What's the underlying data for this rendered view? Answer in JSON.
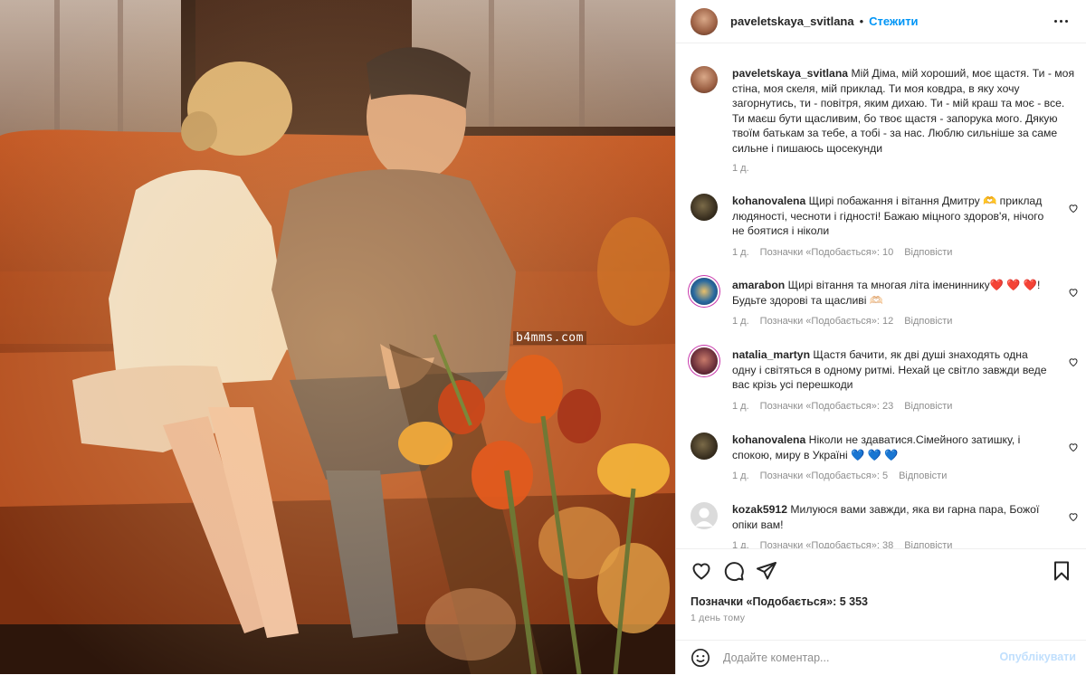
{
  "photo": {
    "watermark": "b4mms.com"
  },
  "header": {
    "username": "paveletskaya_svitlana",
    "separator": "•",
    "follow_label": "Стежити"
  },
  "caption": {
    "username": "paveletskaya_svitlana",
    "text": "Мій Діма, мій хороший, моє щастя. Ти - моя стіна, моя скеля, мій приклад. Ти моя ковдра, в яку хочу загорнутись, ти - повітря, яким дихаю. Ти - мій краш та моє - все. Ти маєш бути щасливим, бо твоє щастя - запорука мого. Дякую твоїм батькам за тебе, а тобі - за нас. Люблю сильніше за саме сильне і пишаюсь щосекунди",
    "time": "1 д."
  },
  "comments": [
    {
      "username": "kohanovalena",
      "text": "Щирі побажання і вітання Дмитру 🫶 приклад людяності, чесноти і гідності! Бажаю міцного здоров'я, нічого не боятися і ніколи",
      "time": "1 д.",
      "likes": "Позначки «Подобається»: 10",
      "reply": "Відповісти"
    },
    {
      "username": "amarabon",
      "text": "Щирі вітання та многая літа імениннику❤️ ❤️ ❤️! Будьте здорові та щасливі 🫶🏻",
      "time": "1 д.",
      "likes": "Позначки «Подобається»: 12",
      "reply": "Відповісти"
    },
    {
      "username": "natalia_martyn",
      "text": "Щастя бачити, як дві душі знаходять одна одну і світяться в одному ритмі. Нехай це світло завжди веде вас крізь усі перешкоди",
      "time": "1 д.",
      "likes": "Позначки «Подобається»: 23",
      "reply": "Відповісти"
    },
    {
      "username": "kohanovalena",
      "text": "Ніколи не здаватися.Сімейного затишку, і спокою, миру в Україні 💙 💙 💙",
      "time": "1 д.",
      "likes": "Позначки «Подобається»: 5",
      "reply": "Відповісти"
    },
    {
      "username": "kozak5912",
      "text": "Милуюся вами завжди, яка ви гарна пара, Божої опіки вам!",
      "time": "1 д.",
      "likes": "Позначки «Подобається»: 38",
      "reply": "Відповісти"
    }
  ],
  "footer": {
    "likes": "Позначки «Подобається»: 5 353",
    "time": "1 день тому",
    "comment_placeholder": "Додайте коментар...",
    "post_label": "Опублікувати"
  },
  "colors": {
    "link": "#0095f6",
    "muted": "#8e8e8e",
    "text": "#262626",
    "post_disabled": "#c0dffd"
  }
}
